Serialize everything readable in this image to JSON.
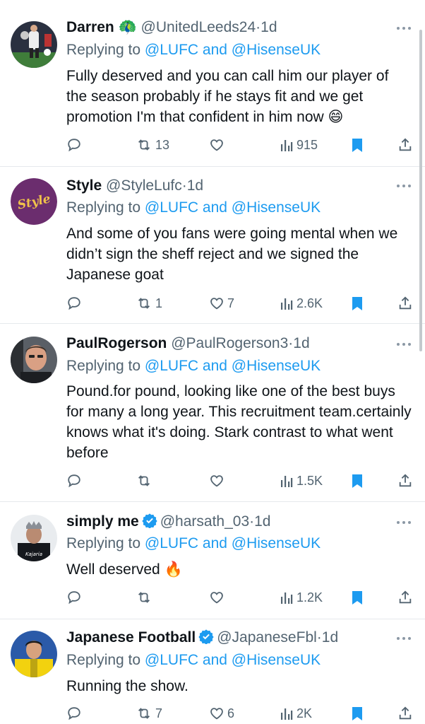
{
  "reply_prefix": "Replying to",
  "tweets": [
    {
      "name": "Darren",
      "emoji_after_name": "🦚",
      "handle": "@UnitedLeeds24",
      "dot": "·",
      "age": "1d",
      "mentions": "@LUFC and @HisenseUK",
      "text": "Fully deserved and you can call him our player of the season probably if he stays fit and we get promotion I'm that confident in him now 😄",
      "reposts": "13",
      "likes": "",
      "views": "915",
      "avatar_icon": "footballer-photo"
    },
    {
      "name": "Style",
      "handle": "@StyleLufc",
      "dot": "·",
      "age": "1d",
      "mentions": "@LUFC and @HisenseUK",
      "text": "And some of you fans were going mental when we didn’t sign the sheff reject and we signed the Japanese goat",
      "reposts": "1",
      "likes": "7",
      "views": "2.6K",
      "avatar_text": "Style",
      "avatar_color": "#6b2d6e"
    },
    {
      "name": "PaulRogerson",
      "handle": "@PaulRogerson3",
      "dot": "·",
      "age": "1d",
      "mentions": "@LUFC and @HisenseUK",
      "text": "Pound.for pound, looking like one of the best buys for many a long year. This recruitment team.certainly knows what it's doing. Stark contrast to what went before",
      "reposts": "",
      "likes": "",
      "views": "1.5K",
      "avatar_icon": "man-photo"
    },
    {
      "name": "simply me",
      "verified": true,
      "handle": "@harsath_03",
      "dot": "·",
      "age": "1d",
      "mentions": "@LUFC and @HisenseUK",
      "text": "Well deserved 🔥",
      "reposts": "",
      "likes": "",
      "views": "1.2K",
      "avatar_icon": "player-crown-photo",
      "avatar_text": "Kajaria"
    },
    {
      "name": "Japanese Football",
      "verified": true,
      "handle": "@JapaneseFbl",
      "dot": "·",
      "age": "1d",
      "mentions": "@LUFC and @HisenseUK",
      "text": "Running the show.",
      "reposts": "7",
      "likes": "6",
      "views": "2K",
      "avatar_icon": "player-yellow-kit-photo"
    }
  ],
  "colors": {
    "accent": "#1d9bf0",
    "secondary_text": "#536471",
    "primary_text": "#0f1419",
    "divider": "#e6e9ec"
  },
  "icons": [
    "reply-icon",
    "repost-icon",
    "like-icon",
    "views-icon",
    "bookmark-icon",
    "share-icon",
    "more-icon",
    "verified-badge-icon"
  ]
}
